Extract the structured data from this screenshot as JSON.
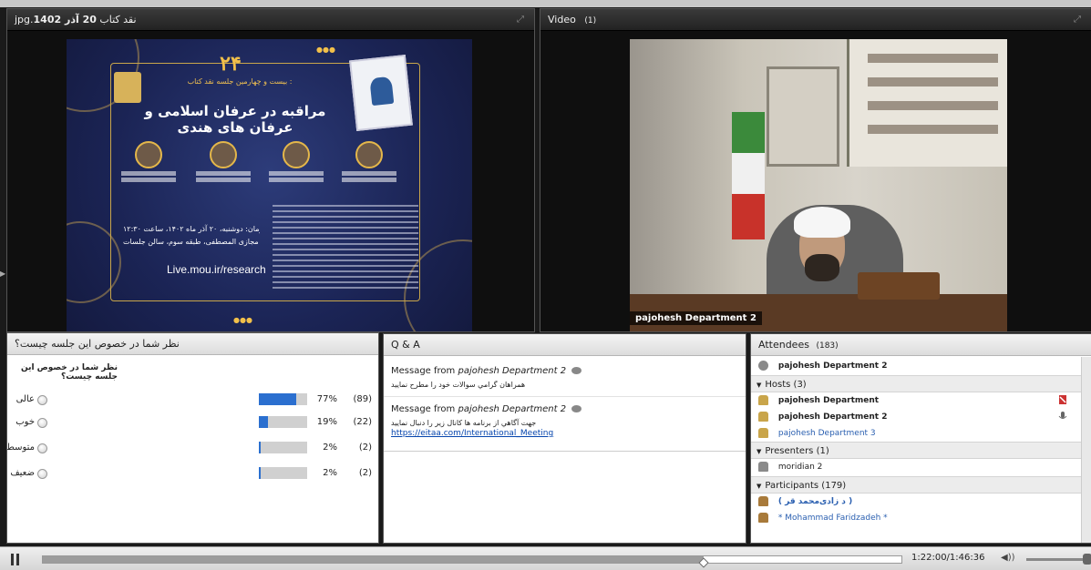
{
  "share": {
    "title_prefix": "jpg.نقد کتاب",
    "title_date": "20 آذر 1402",
    "poster": {
      "number": "۲۴",
      "subtitle": "بیست و چهارمین جلسه نقد کتاب :",
      "title": "مراقبه در عرفان اسلامی و عرفان های هندی",
      "time_line": "زمان: دوشنبه، ۲۰ آذر ماه ۱۴۰۲، ساعت ۱۲:۳۰",
      "place_line": "مکان: دانشگاه مجازی المصطفی، طبقه سوم، سالن جلسات",
      "url": "Live.mou.ir/research"
    }
  },
  "video": {
    "title": "Video",
    "count": "(1)",
    "camera_label": "pajohesh Department 2"
  },
  "poll": {
    "header": "نظر شما در خصوص این جلسه چیست؟",
    "question": "نظر شما در خصوص این جلسه چیست؟",
    "options": [
      {
        "label": "عالی",
        "pct": "77%",
        "count": "(89)",
        "fraction": 0.77
      },
      {
        "label": "خوب",
        "pct": "19%",
        "count": "(22)",
        "fraction": 0.19
      },
      {
        "label": "متوسط",
        "pct": "2%",
        "count": "(2)",
        "fraction": 0.02
      },
      {
        "label": "ضعیف",
        "pct": "2%",
        "count": "(2)",
        "fraction": 0.02
      }
    ]
  },
  "qa": {
    "title": "Q & A",
    "messages": [
      {
        "from_prefix": "Message from",
        "from_name": "pajohesh Department 2",
        "text": "همراهان گرامي سوالات خود را مطرح نماييد",
        "link": ""
      },
      {
        "from_prefix": "Message from",
        "from_name": "pajohesh Department 2",
        "text": "جهت آگاهي از برنامه ها كانال زير را دنبال نماييد",
        "link": "https://eitaa.com/International_Meeting"
      }
    ]
  },
  "attendees": {
    "title": "Attendees",
    "count": "(183)",
    "current_user": "pajohesh Department 2",
    "groups": {
      "hosts": "Hosts (3)",
      "presenters": "Presenters (1)",
      "participants": "Participants (179)"
    },
    "hosts": [
      "pajohesh Department",
      "pajohesh Department 2",
      "pajohesh Department 3"
    ],
    "presenters": [
      "moridian 2"
    ],
    "participants": [
      "( د زادی‌محمد قر )",
      "* Mohammad Faridzadeh *"
    ]
  },
  "playback": {
    "timecode": "1:22:00/1:46:36",
    "progress": 0.77
  }
}
